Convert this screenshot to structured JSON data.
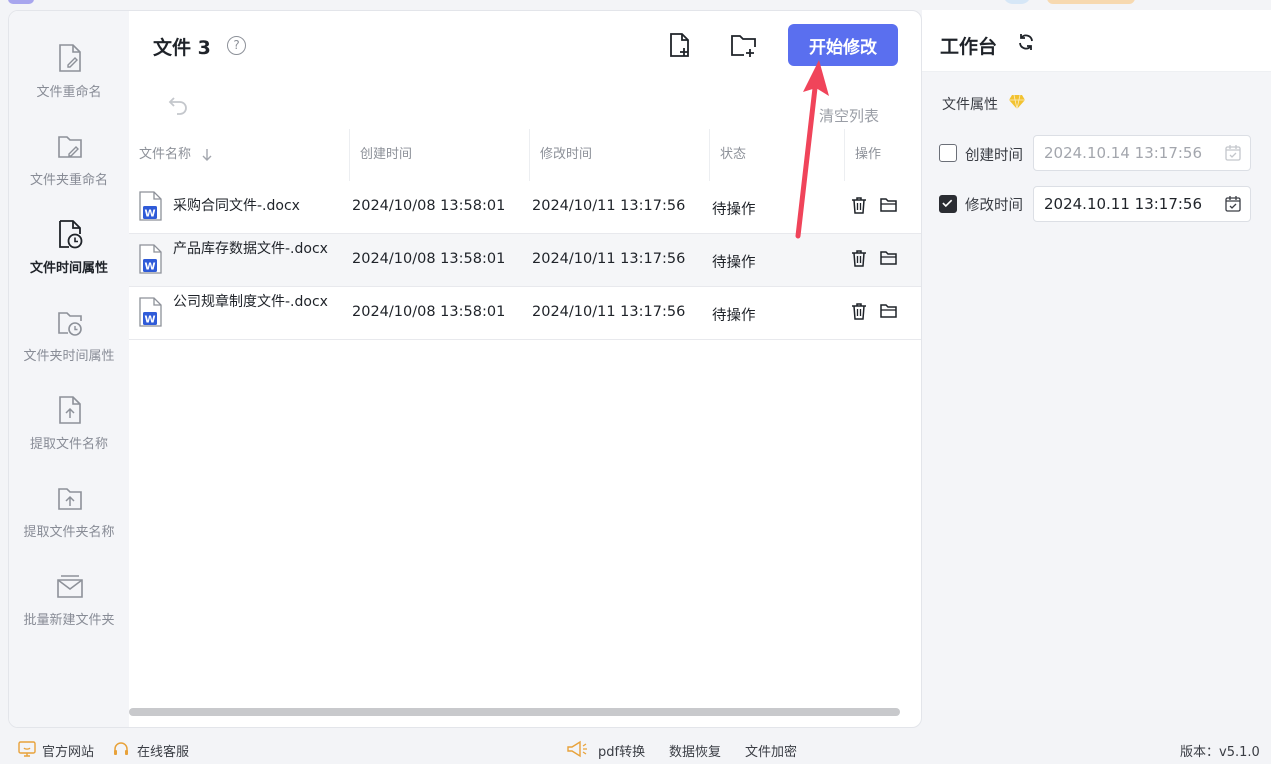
{
  "sidebar": {
    "items": [
      {
        "label": "文件重命名",
        "icon": "file-edit-icon",
        "active": false
      },
      {
        "label": "文件夹重命名",
        "icon": "folder-edit-icon",
        "active": false
      },
      {
        "label": "文件时间属性",
        "icon": "file-clock-icon",
        "active": true
      },
      {
        "label": "文件夹时间属性",
        "icon": "folder-clock-icon",
        "active": false
      },
      {
        "label": "提取文件名称",
        "icon": "file-upload-icon",
        "active": false
      },
      {
        "label": "提取文件夹名称",
        "icon": "folder-upload-icon",
        "active": false
      },
      {
        "label": "批量新建文件夹",
        "icon": "folder-stack-icon",
        "active": false
      }
    ]
  },
  "main": {
    "title": "文件 3",
    "help_icon": "?",
    "start_button": "开始修改",
    "clear_list": "清空列表",
    "columns": [
      "文件名称",
      "创建时间",
      "修改时间",
      "状态",
      "操作"
    ],
    "rows": [
      {
        "name": "采购合同文件-.docx",
        "created": "2024/10/08 13:58:01",
        "modified": "2024/10/11 13:17:56",
        "status": "待操作"
      },
      {
        "name": "产品库存数据文件-.docx",
        "created": "2024/10/08 13:58:01",
        "modified": "2024/10/11 13:17:56",
        "status": "待操作"
      },
      {
        "name": "公司规章制度文件-.docx",
        "created": "2024/10/08 13:58:01",
        "modified": "2024/10/11 13:17:56",
        "status": "待操作"
      }
    ],
    "doc_icon_letter": "W"
  },
  "panel": {
    "title": "工作台",
    "attr_label": "文件属性",
    "create": {
      "label": "创建时间",
      "value": "2024.10.14 13:17:56",
      "checked": false
    },
    "modify": {
      "label": "修改时间",
      "value": "2024.10.11 13:17:56",
      "checked": true
    }
  },
  "footer": {
    "website": "官方网站",
    "support": "在线客服",
    "pdf": "pdf转换",
    "recover": "数据恢复",
    "encrypt": "文件加密",
    "version": "版本：v5.1.0"
  },
  "colors": {
    "accent": "#5a6fef",
    "arrow": "#f0445a",
    "diamond": "#f2c230"
  }
}
